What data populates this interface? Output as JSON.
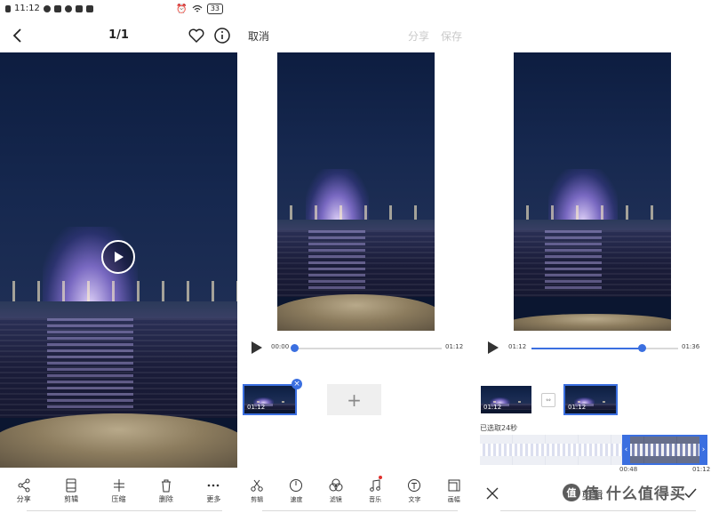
{
  "status_bar": {
    "time": "11:12",
    "battery": "33"
  },
  "viewer": {
    "counter": "1/1",
    "actions": [
      {
        "label": "分享",
        "icon": "share-icon"
      },
      {
        "label": "剪辑",
        "icon": "film-icon"
      },
      {
        "label": "压缩",
        "icon": "compress-icon"
      },
      {
        "label": "删除",
        "icon": "trash-icon"
      },
      {
        "label": "更多",
        "icon": "more-icon"
      }
    ]
  },
  "editor": {
    "cancel_label": "取消",
    "share_label": "分享",
    "save_label": "保存",
    "current_time": "00:00",
    "total_time": "01:12",
    "clip_duration": "01:12",
    "tools": [
      {
        "label": "剪辑",
        "icon": "scissors-icon"
      },
      {
        "label": "速度",
        "icon": "speed-icon"
      },
      {
        "label": "滤镜",
        "icon": "filter-icon"
      },
      {
        "label": "音乐",
        "icon": "music-icon"
      },
      {
        "label": "文字",
        "icon": "text-icon"
      },
      {
        "label": "画幅",
        "icon": "aspect-ratio-icon"
      }
    ]
  },
  "trim": {
    "current_time": "01:12",
    "total_time": "01:36",
    "progress": 0.75,
    "clip1_duration": "01:12",
    "clip2_duration": "01:12",
    "selected_label": "已选取24秒",
    "range_start": "00:48",
    "range_end": "01:12",
    "title": "剪辑"
  },
  "watermark": {
    "text": "值 什么值得买",
    "logo": "值"
  },
  "colors": {
    "accent": "#3b6fe0",
    "disabled": "#c9c9c9",
    "music_dot": "#e0312d"
  }
}
